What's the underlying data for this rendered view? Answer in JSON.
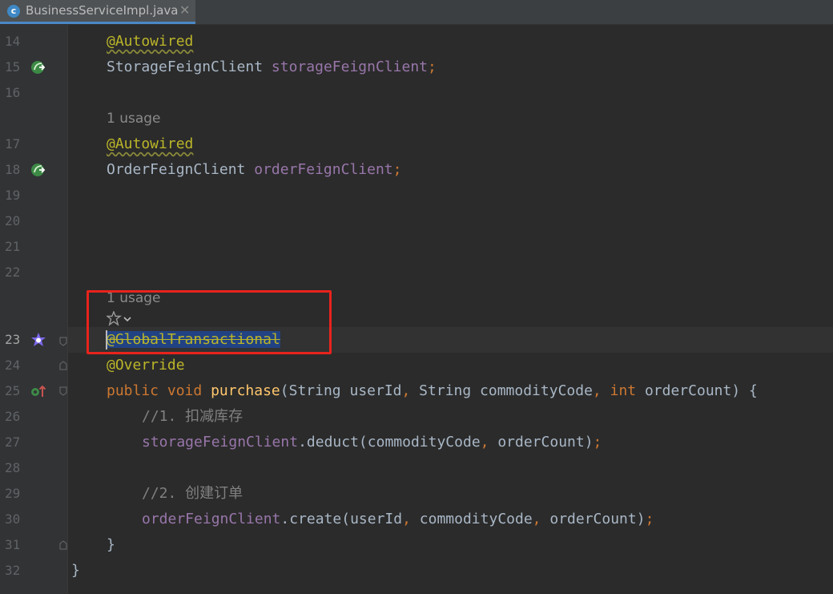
{
  "tab": {
    "icon_letter": "c",
    "title": "BusinessServiceImpl.java",
    "close_glyph": "✕"
  },
  "gutter": {
    "line_numbers": [
      "14",
      "15",
      "16",
      "17",
      "18",
      "19",
      "20",
      "21",
      "22",
      "23",
      "24",
      "25",
      "26",
      "27",
      "28",
      "29",
      "30",
      "31",
      "32"
    ],
    "active_line": "23"
  },
  "hints": {
    "usage_1": "1 usage",
    "usage_2": "1 usage"
  },
  "code": {
    "l14": {
      "ann": "@Autowired"
    },
    "l15": {
      "type": "StorageFeignClient",
      "field": "storageFeignClient",
      "semi": ";"
    },
    "l17": {
      "ann": "@Autowired"
    },
    "l18": {
      "type": "OrderFeignClient",
      "field": "orderFeignClient",
      "semi": ";"
    },
    "l23": {
      "ann": "@GlobalTransactional"
    },
    "l24": {
      "ann": "@Override"
    },
    "l25": {
      "kw1": "public",
      "kw2": "void",
      "fn": "purchase",
      "p1": "(String userId",
      "c1": ",",
      "p2": " String commodityCode",
      "c2": ",",
      "kw3": "int",
      "p3": " orderCount) {"
    },
    "l26": {
      "comment": "//1. 扣减库存"
    },
    "l27": {
      "field": "storageFeignClient",
      "call": ".deduct(commodityCode",
      "c1": ",",
      "rest": " orderCount)",
      "semi": ";"
    },
    "l29": {
      "comment": "//2. 创建订单"
    },
    "l30": {
      "field": "orderFeignClient",
      "call": ".create(userId",
      "c1": ",",
      "p2": " commodityCode",
      "c2": ",",
      "rest": " orderCount)",
      "semi": ";"
    },
    "l31": {
      "text": "}"
    },
    "l32": {
      "text": "}"
    }
  },
  "colors": {
    "accent_red": "#e8231c",
    "spring_green": "#3d8a46",
    "seata_purple": "#7b68ee"
  }
}
